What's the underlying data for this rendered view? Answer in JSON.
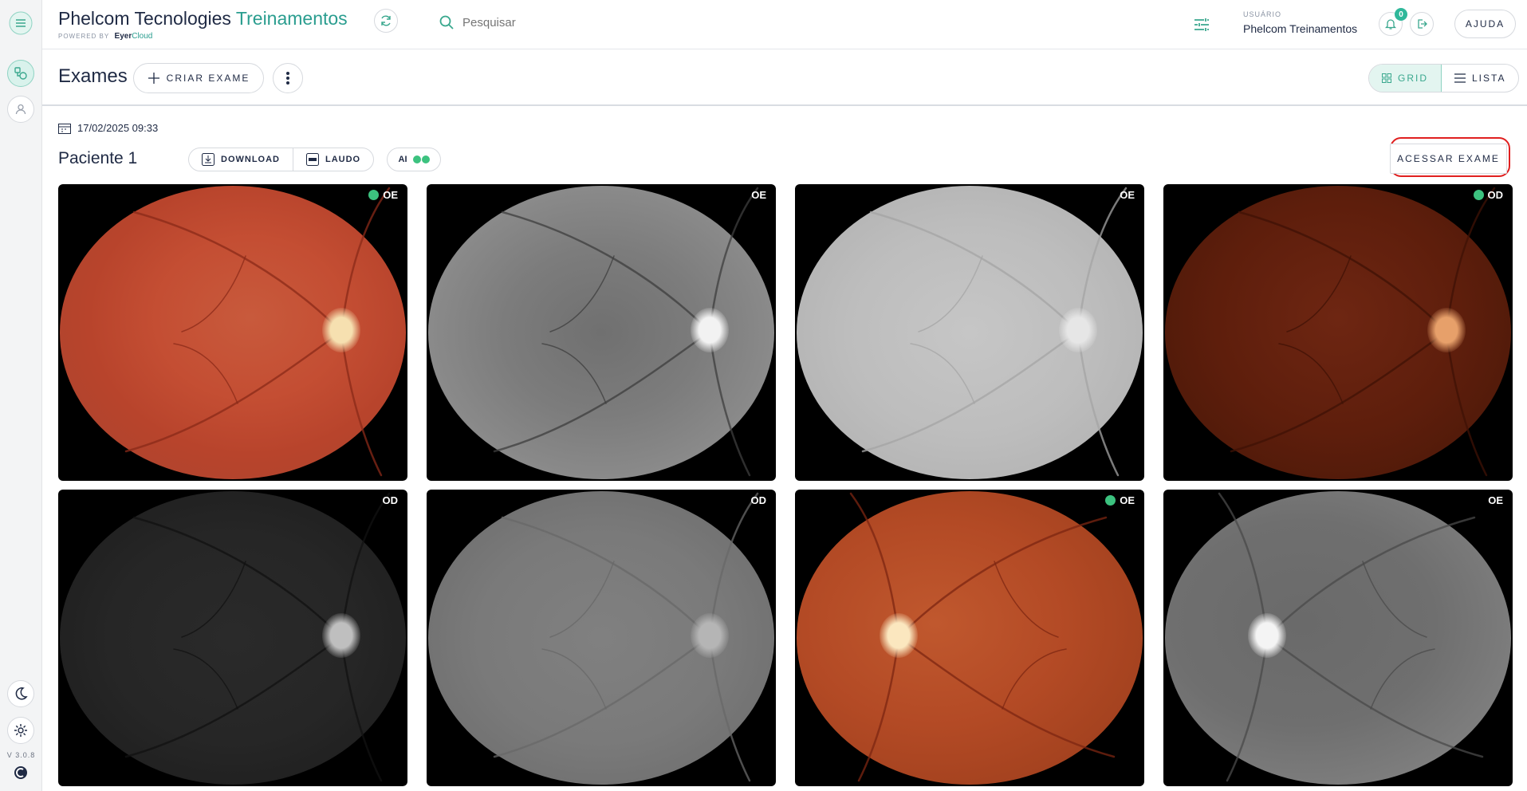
{
  "app": {
    "title_main": "Phelcom Tecnologies",
    "title_accent": "Treinamentos",
    "powered_by_label": "POWERED BY",
    "powered_by_brand_1": "Eyer",
    "powered_by_brand_2": "Cloud",
    "version": "V 3.0.8"
  },
  "search": {
    "placeholder": "Pesquisar"
  },
  "user": {
    "label": "USUÁRIO",
    "name": "Phelcom Treinamentos",
    "notifications": "0"
  },
  "header": {
    "help_label": "AJUDA"
  },
  "toolbar": {
    "title": "Exames",
    "create_label": "CRIAR EXAME",
    "grid_label": "GRID",
    "list_label": "LISTA",
    "active_view": "grid"
  },
  "exam": {
    "datetime": "17/02/2025 09:33",
    "patient": "Paciente 1",
    "download_label": "DOWNLOAD",
    "report_label": "LAUDO",
    "ai_label": "AI",
    "access_label": "ACESSAR EXAME"
  },
  "images": [
    {
      "eye": "OE",
      "ai_marked": true,
      "style": "color-red"
    },
    {
      "eye": "OE",
      "ai_marked": false,
      "style": "gray-dark"
    },
    {
      "eye": "OE",
      "ai_marked": false,
      "style": "gray-light"
    },
    {
      "eye": "OD",
      "ai_marked": true,
      "style": "color-dark"
    },
    {
      "eye": "OD",
      "ai_marked": false,
      "style": "gray-black"
    },
    {
      "eye": "OD",
      "ai_marked": false,
      "style": "gray-mid"
    },
    {
      "eye": "OE",
      "ai_marked": true,
      "style": "color-orange"
    },
    {
      "eye": "OE",
      "ai_marked": false,
      "style": "gray-vessels"
    }
  ],
  "colors": {
    "accent": "#2a9d8f",
    "ai_dot": "#3cc27f",
    "highlight_ring": "#e02020"
  }
}
